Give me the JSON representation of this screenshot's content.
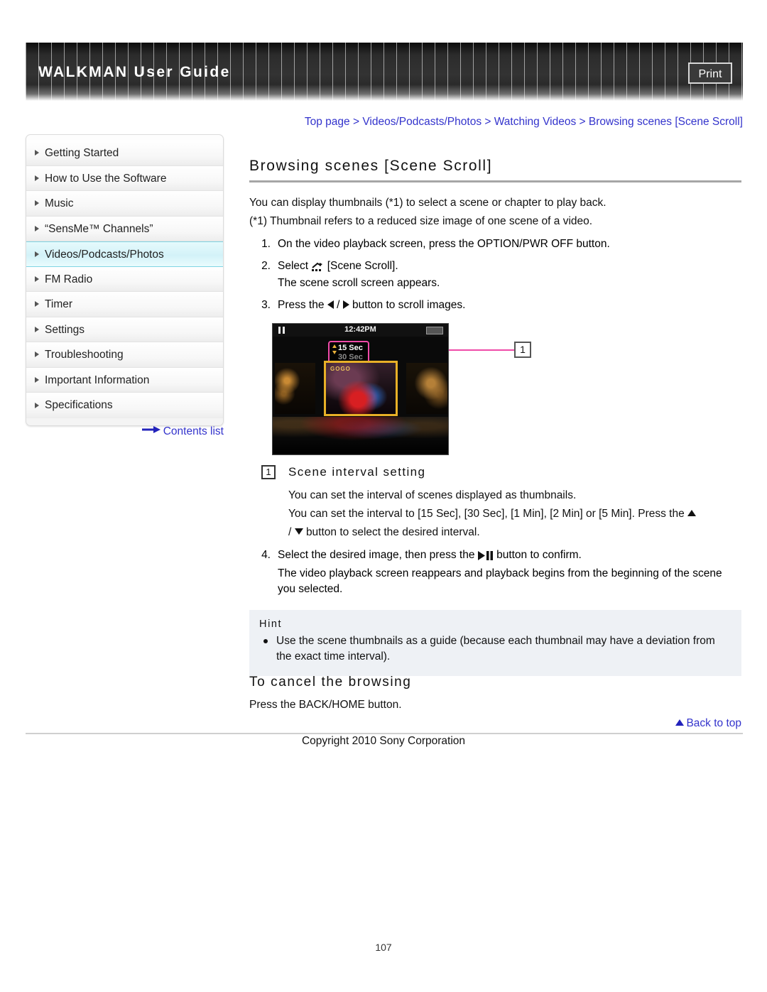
{
  "header": {
    "title": "WALKMAN User Guide",
    "print_label": "Print"
  },
  "breadcrumb": {
    "items": [
      "Top page",
      "Videos/Podcasts/Photos",
      "Watching Videos",
      "Browsing scenes [Scene Scroll]"
    ],
    "separator": ">",
    "full_text": "Top page > Videos/Podcasts/Photos > Watching Videos > Browsing scenes [Scene Scroll]"
  },
  "sidebar": {
    "items": [
      {
        "label": "Getting Started",
        "selected": false
      },
      {
        "label": "How to Use the Software",
        "selected": false
      },
      {
        "label": "Music",
        "selected": false
      },
      {
        "label": "“SensMe™ Channels”",
        "selected": false
      },
      {
        "label": "Videos/Podcasts/Photos",
        "selected": true
      },
      {
        "label": "FM Radio",
        "selected": false
      },
      {
        "label": "Timer",
        "selected": false
      },
      {
        "label": "Settings",
        "selected": false
      },
      {
        "label": "Troubleshooting",
        "selected": false
      },
      {
        "label": "Important Information",
        "selected": false
      },
      {
        "label": "Specifications",
        "selected": false
      }
    ],
    "contents_list_label": "Contents list"
  },
  "main": {
    "title": "Browsing scenes [Scene Scroll]",
    "intro": "You can display thumbnails (*1) to select a scene or chapter to play back.",
    "footnote": "(*1) Thumbnail refers to a reduced size image of one scene of a video.",
    "steps": [
      {
        "num": "1.",
        "text": "On the video playback screen, press the OPTION/PWR OFF button.",
        "sub": ""
      },
      {
        "num": "2.",
        "text_before_icon": "Select",
        "text_after_icon": "[Scene Scroll].",
        "sub": "The scene scroll screen appears."
      },
      {
        "num": "3.",
        "text_before_icon": "Press the",
        "icon_separator": "/",
        "text_after_icon": "button to scroll images.",
        "sub": ""
      }
    ],
    "step4": {
      "num": "4.",
      "text_before_icon": "Select the desired image, then press the",
      "text_after_icon": "button to confirm.",
      "sub": "The video playback screen reappears and playback begins from the beginning of the scene you selected."
    },
    "callout": {
      "marker": "1",
      "title": "Scene interval setting",
      "line1": "You can set the interval of scenes displayed as thumbnails.",
      "line2_before_icon": "You can set the interval to [15 Sec], [30 Sec], [1 Min], [2 Min] or [5 Min]. Press the",
      "line2_separator": "/",
      "line2_after_icon": "button to select the desired interval."
    },
    "hint": {
      "title": "Hint",
      "items": [
        "Use the scene thumbnails as a guide (because each thumbnail may have a deviation from the exact time interval)."
      ]
    },
    "cancel_section": {
      "title": "To cancel the browsing",
      "body": "Press the BACK/HOME button."
    }
  },
  "device_screenshot": {
    "status_time": "12:42PM",
    "interval_selected": "15 Sec",
    "interval_next": "30 Sec",
    "thumbnail_banner": "GOGO",
    "callout_number": "1"
  },
  "footer": {
    "back_to_top": "Back to top",
    "copyright": "Copyright 2010 Sony Corporation",
    "page_number": "107"
  },
  "colors": {
    "link": "#3333cc",
    "highlight_border": "#7fd4e3",
    "callout_pink": "#ef4aa8",
    "hint_bg": "#eef1f5"
  }
}
